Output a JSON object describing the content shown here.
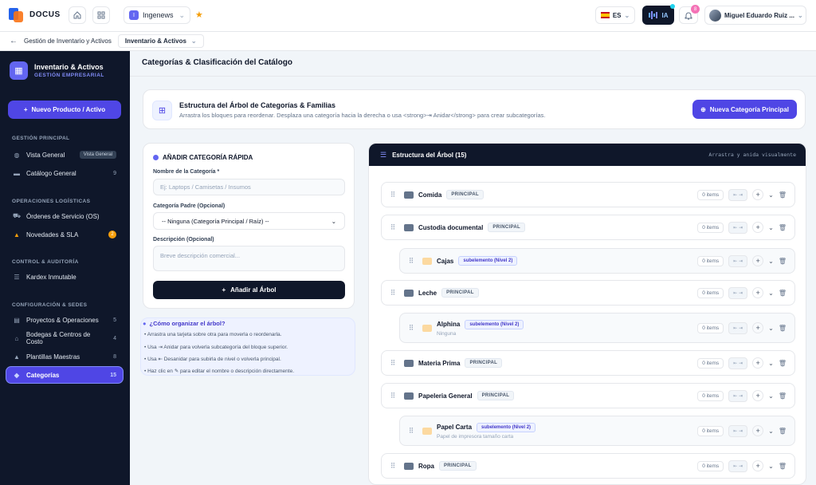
{
  "app": {
    "brand": "DOCUS",
    "org": "Ingenews",
    "lang": "ES",
    "ia_label": "IA",
    "notifications": "8",
    "user": "Miguel Eduardo Ruiz ..."
  },
  "breadcrumb": {
    "parent": "Gestión de Inventario y Activos",
    "current": "Inventario & Activos"
  },
  "sidebar": {
    "title": "Inventario & Activos",
    "subtitle": "GESTIÓN EMPRESARIAL",
    "new_button": "Nuevo Producto / Activo",
    "sections": [
      {
        "label": "GESTIÓN PRINCIPAL",
        "items": [
          {
            "label": "Vista General",
            "icon": "dashboard-icon",
            "badge": "Vista General"
          },
          {
            "label": "Catálogo General",
            "icon": "briefcase-icon",
            "count": "9"
          }
        ]
      },
      {
        "label": "OPERACIONES LOGÍSTICAS",
        "items": [
          {
            "label": "Órdenes de Servicio (OS)",
            "icon": "truck-icon"
          },
          {
            "label": "Novedades & SLA",
            "icon": "alert-icon",
            "badge": "2"
          }
        ]
      },
      {
        "label": "CONTROL & AUDITORÍA",
        "items": [
          {
            "label": "Kardex Inmutable",
            "icon": "list-icon"
          }
        ]
      },
      {
        "label": "CONFIGURACIÓN & SEDES",
        "items": [
          {
            "label": "Proyectos & Operaciones",
            "icon": "project-icon",
            "count": "5"
          },
          {
            "label": "Bodegas & Centros de Costo",
            "icon": "warehouse-icon",
            "count": "4"
          },
          {
            "label": "Plantillas Maestras",
            "icon": "template-icon",
            "count": "8"
          },
          {
            "label": "Categorías",
            "icon": "tag-icon",
            "count": "15"
          }
        ]
      }
    ]
  },
  "main": {
    "title": "Categorías & Clasificación del Catálogo",
    "banner": {
      "title": "Estructura del Árbol de Categorías & Familias",
      "description": "Arrastra los bloques para reordenar. Desplaza una categoría hacia la derecha o usa <strong>⇥ Anidar</strong> para crear subcategorías.",
      "button": "Nueva Categoría Principal"
    },
    "form": {
      "title": "AÑADIR CATEGORÍA RÁPIDA",
      "name_label": "Nombre de la Categoría *",
      "name_placeholder": "Ej: Laptops / Camisetas / Insumos",
      "parent_label": "Categoría Padre (Opcional)",
      "parent_value": "-- Ninguna (Categoría Principal / Raíz) --",
      "desc_label": "Descripción (Opcional)",
      "desc_placeholder": "Breve descripción comercial...",
      "submit": "Añadir al Árbol"
    },
    "tips": {
      "title": "¿Cómo organizar el árbol?",
      "items": [
        "Arrastra una tarjeta sobre otra para moverla o reordenarla.",
        "Usa ⇥ Anidar para volverla subcategoría del bloque superior.",
        "Usa ⇤ Desanidar para subirla de nivel o volverla principal.",
        "Haz clic en ✎ para editar el nombre o descripción directamente."
      ]
    },
    "tree": {
      "title": "Estructura del Árbol (15)",
      "hint": "Arrastra y anida visualmente",
      "rows": [
        {
          "name": "Comida",
          "tag": "PRINCIPAL",
          "items": "0 items"
        },
        {
          "name": "Custodia documental",
          "tag": "PRINCIPAL",
          "items": "0 items"
        },
        {
          "name": "Cajas",
          "tag": "subelemento (Nivel 2)",
          "items": "0 items"
        },
        {
          "name": "Leche",
          "tag": "PRINCIPAL",
          "items": "0 items"
        },
        {
          "name": "Alphina",
          "tag": "subelemento (Nivel 2)",
          "desc": "Ninguna",
          "items": "0 items"
        },
        {
          "name": "Materia Prima",
          "tag": "PRINCIPAL",
          "items": "0 items"
        },
        {
          "name": "Papeleria General",
          "tag": "PRINCIPAL",
          "items": "0 items"
        },
        {
          "name": "Papel Carta",
          "tag": "subelemento (Nivel 2)",
          "desc": "Papel de impresora tamaño carta",
          "items": "0 items"
        },
        {
          "name": "Ropa",
          "tag": "PRINCIPAL",
          "items": "0 items"
        }
      ]
    }
  }
}
